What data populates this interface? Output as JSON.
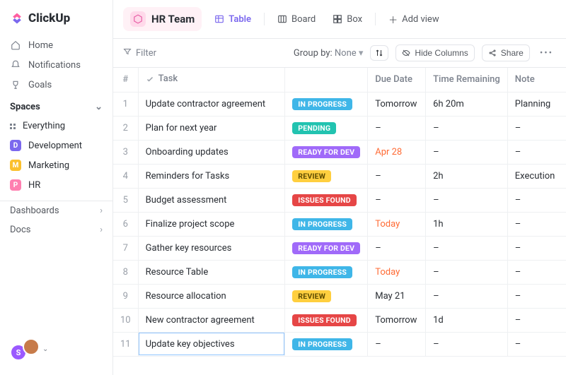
{
  "brand": "ClickUp",
  "nav": {
    "home": "Home",
    "notifications": "Notifications",
    "goals": "Goals"
  },
  "spaces": {
    "header": "Spaces",
    "everything": "Everything",
    "items": [
      {
        "initial": "D",
        "label": "Development",
        "color": "#7b68ee"
      },
      {
        "initial": "M",
        "label": "Marketing",
        "color": "#fbc02d"
      },
      {
        "initial": "P",
        "label": "HR",
        "color": "#ff7fb0"
      }
    ]
  },
  "sideBottom": {
    "dashboards": "Dashboards",
    "docs": "Docs"
  },
  "avatars": [
    {
      "initial": "S",
      "color": "#9b59ff"
    },
    {
      "initial": "",
      "color": "#c77b4a"
    }
  ],
  "team": {
    "name": "HR Team"
  },
  "views": {
    "table": "Table",
    "board": "Board",
    "box": "Box",
    "add": "Add view"
  },
  "toolbar": {
    "filter": "Filter",
    "groupby_label": "Group by:",
    "groupby_value": "None",
    "hide_columns": "Hide Columns",
    "share": "Share"
  },
  "columns": {
    "num": "#",
    "task": "Task",
    "due": "Due Date",
    "time": "Time Remaining",
    "note": "Note"
  },
  "statusColors": {
    "IN PROGRESS": "#3fb6e8",
    "PENDING": "#22c3b0",
    "READY FOR DEV": "#a06af9",
    "REVIEW": "#ffcf3f",
    "ISSUES FOUND": "#e64646"
  },
  "statusTextDark": [
    "REVIEW"
  ],
  "dueOrange": [
    "Apr 28",
    "Today"
  ],
  "rows": [
    {
      "n": 1,
      "task": "Update contractor agreement",
      "status": "IN PROGRESS",
      "due": "Tomorrow",
      "time": "6h 20m",
      "note": "Planning"
    },
    {
      "n": 2,
      "task": "Plan for next year",
      "status": "PENDING",
      "due": "–",
      "time": "–",
      "note": "–"
    },
    {
      "n": 3,
      "task": "Onboarding updates",
      "status": "READY FOR DEV",
      "due": "Apr 28",
      "time": "–",
      "note": "–"
    },
    {
      "n": 4,
      "task": "Reminders for Tasks",
      "status": "REVIEW",
      "due": "–",
      "time": "2h",
      "note": "Execution"
    },
    {
      "n": 5,
      "task": "Budget assessment",
      "status": "ISSUES FOUND",
      "due": "–",
      "time": "–",
      "note": "–"
    },
    {
      "n": 6,
      "task": "Finalize project scope",
      "status": "IN PROGRESS",
      "due": "Today",
      "time": "1h",
      "note": "–"
    },
    {
      "n": 7,
      "task": "Gather key resources",
      "status": "READY FOR DEV",
      "due": "–",
      "time": "–",
      "note": "–"
    },
    {
      "n": 8,
      "task": "Resource Table",
      "status": "IN PROGRESS",
      "due": "Today",
      "time": "–",
      "note": "–"
    },
    {
      "n": 9,
      "task": "Resource allocation",
      "status": "REVIEW",
      "due": "May 21",
      "time": "–",
      "note": "–"
    },
    {
      "n": 10,
      "task": "New contractor agreement",
      "status": "ISSUES FOUND",
      "due": "Tomorrow",
      "time": "1d",
      "note": "–"
    },
    {
      "n": 11,
      "task": "Update key objectives",
      "status": "IN PROGRESS",
      "due": "–",
      "time": "–",
      "note": "–",
      "editing": true
    }
  ]
}
